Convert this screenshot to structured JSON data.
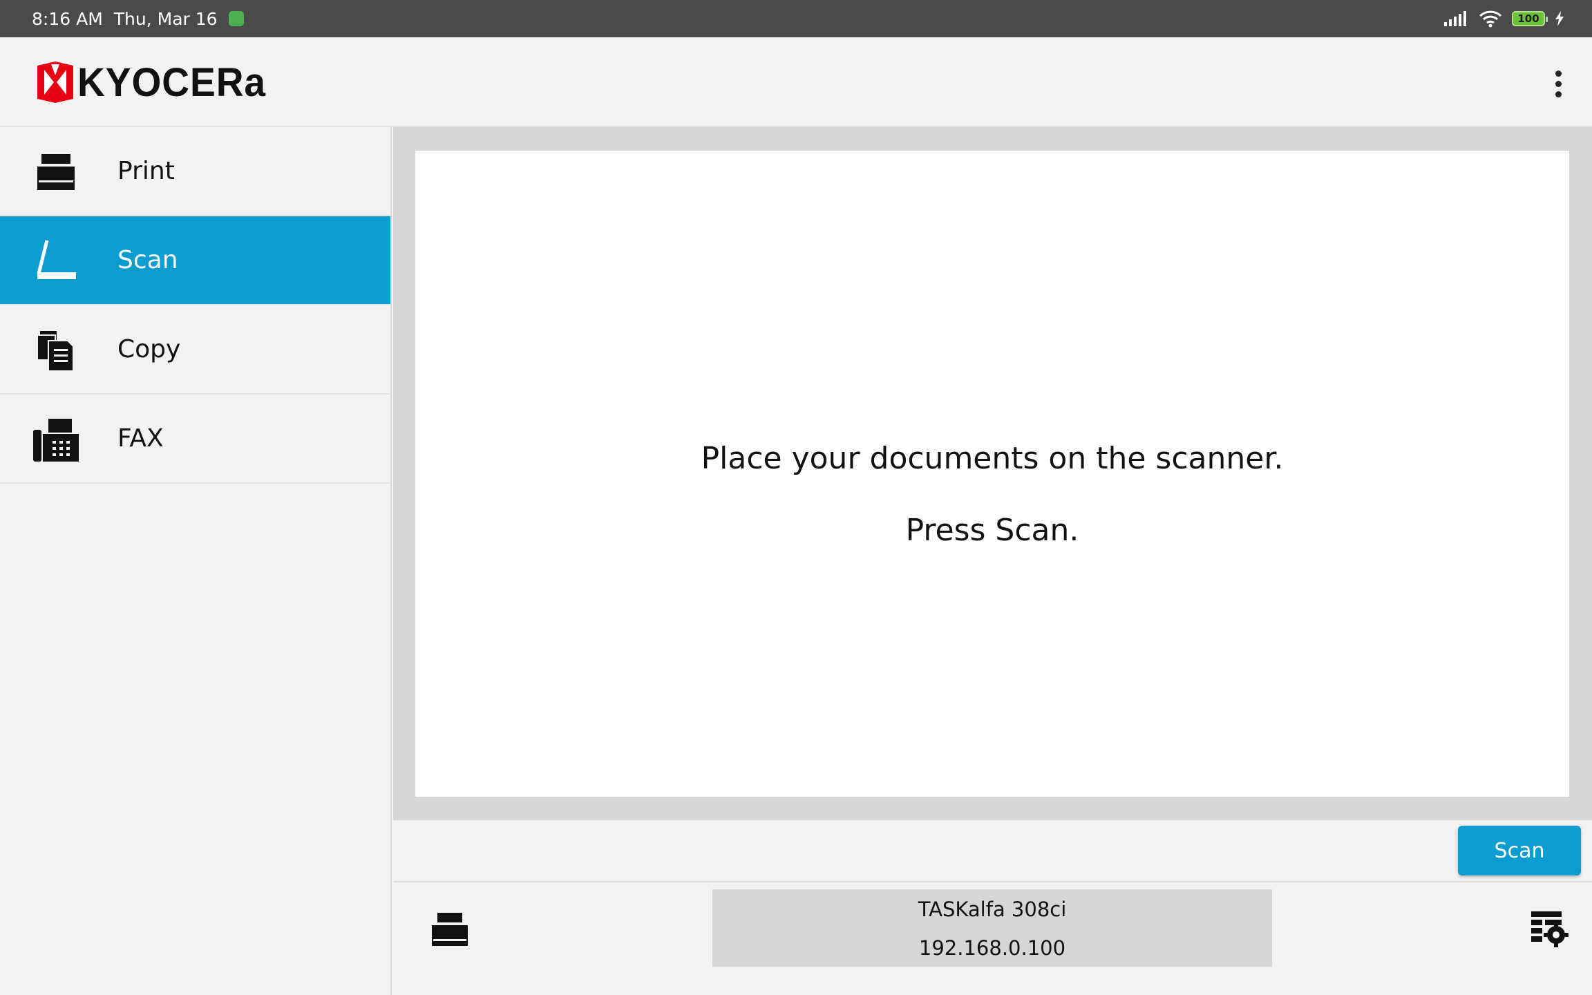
{
  "status_bar": {
    "time": "8:16 AM",
    "date": "Thu, Mar 16",
    "battery": "100"
  },
  "app_bar": {
    "logo_text": "KYOCERa",
    "brand_color": "#e60012"
  },
  "sidebar": {
    "items": [
      {
        "label": "Print",
        "icon": "printer-icon",
        "active": false
      },
      {
        "label": "Scan",
        "icon": "scanner-icon",
        "active": true
      },
      {
        "label": "Copy",
        "icon": "copy-icon",
        "active": false
      },
      {
        "label": "FAX",
        "icon": "fax-icon",
        "active": false
      }
    ]
  },
  "main": {
    "message_line1": "Place your documents on the scanner.",
    "message_line2": "Press Scan.",
    "scan_button_label": "Scan"
  },
  "device": {
    "name": "TASKalfa 308ci",
    "ip": "192.168.0.100"
  },
  "colors": {
    "accent": "#0c9dd0",
    "status_bar": "#4a4a4a"
  }
}
